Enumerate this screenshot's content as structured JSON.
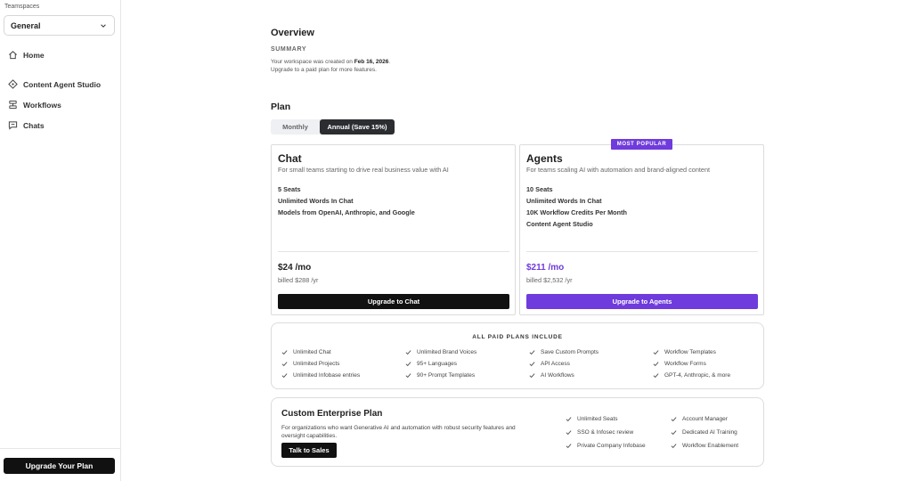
{
  "sidebar": {
    "teamspaces_label": "Teamspaces",
    "teamspace_selected": "General",
    "nav": [
      {
        "label": "Home",
        "icon": "home-icon"
      },
      {
        "label": "Content Agent Studio",
        "icon": "diamond-icon"
      },
      {
        "label": "Workflows",
        "icon": "workflow-icon"
      },
      {
        "label": "Chats",
        "icon": "chat-icon"
      }
    ],
    "upgrade_label": "Upgrade Your Plan"
  },
  "overview": {
    "title": "Overview",
    "summary_label": "SUMMARY",
    "summary_prefix": "Your workspace was created on ",
    "summary_date": "Feb 16, 2026",
    "summary_suffix": ".",
    "summary_line2": "Upgrade to a paid plan for more features."
  },
  "plan": {
    "title": "Plan",
    "toggle": {
      "monthly": "Monthly",
      "annual": "Annual (Save 15%)",
      "selected": "annual"
    },
    "badge": "MOST POPULAR",
    "cards": [
      {
        "name": "Chat",
        "description": "For small teams starting to drive real business value with AI",
        "features": [
          "5 Seats",
          "Unlimited Words In Chat",
          "Models from OpenAI, Anthropic, and Google"
        ],
        "price": "$24 /mo",
        "billed": "billed $288 /yr",
        "button": "Upgrade to Chat"
      },
      {
        "name": "Agents",
        "description": "For teams scaling AI with automation and brand-aligned content",
        "features": [
          "10 Seats",
          "Unlimited Words In Chat",
          "10K Workflow Credits Per Month",
          "Content Agent Studio"
        ],
        "price": "$211 /mo",
        "billed": "billed $2,532 /yr",
        "button": "Upgrade to Agents"
      }
    ]
  },
  "included": {
    "title": "ALL PAID PLANS INCLUDE",
    "columns": [
      [
        "Unlimited Chat",
        "Unlimited Projects",
        "Unlimited Infobase entries"
      ],
      [
        "Unlimited Brand Voices",
        "95+ Languages",
        "90+ Prompt Templates"
      ],
      [
        "Save Custom Prompts",
        "API Access",
        "AI Workflows"
      ],
      [
        "Workflow Templates",
        "Workflow Forms",
        "GPT-4, Anthropic, & more"
      ]
    ]
  },
  "enterprise": {
    "title": "Custom Enterprise Plan",
    "description": "For organizations who want Generative AI and automation with robust security features and oversight capabilities.",
    "button": "Talk to Sales",
    "columns": [
      [
        "Unlimited Seats",
        "SSO & Infosec review",
        "Private Company Infobase"
      ],
      [
        "Account Manager",
        "Dedicated AI Training",
        "Workflow Enablement"
      ]
    ]
  },
  "colors": {
    "accent": "#6f3bdc",
    "dark": "#111111",
    "border": "#dcdcdc"
  }
}
